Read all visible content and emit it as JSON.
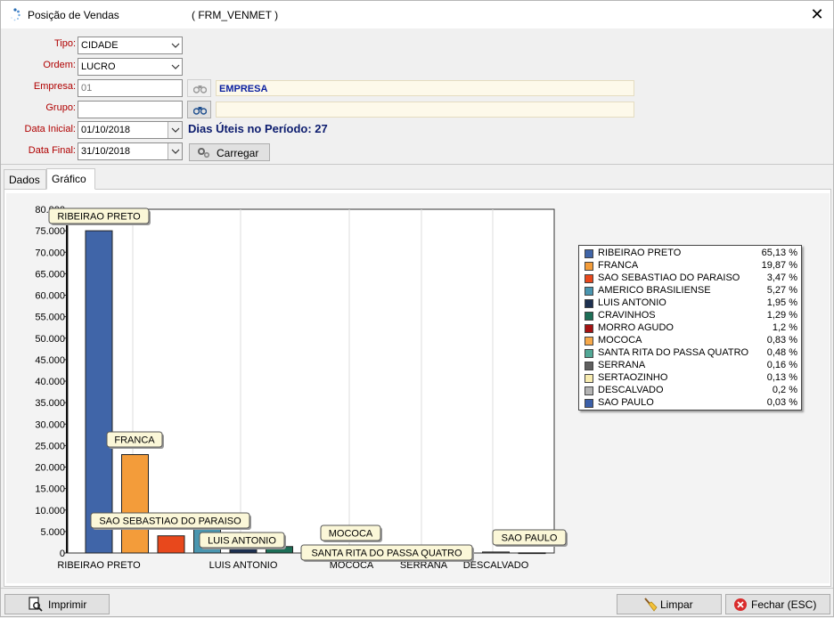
{
  "window": {
    "title": "Posição de Vendas",
    "form_code": "( FRM_VENMET )"
  },
  "filters": {
    "tipo_label": "Tipo:",
    "tipo_value": "CIDADE",
    "ordem_label": "Ordem:",
    "ordem_value": "LUCRO",
    "empresa_label": "Empresa:",
    "empresa_value": "01",
    "empresa_name": "EMPRESA",
    "grupo_label": "Grupo:",
    "grupo_value": "",
    "grupo_name": "",
    "data_inicial_label": "Data Inicial:",
    "data_inicial_value": "01/10/2018",
    "data_final_label": "Data Final:",
    "data_final_value": "31/10/2018",
    "dias_uteis": "Dias Úteis no Período: 27",
    "carregar_label": "Carregar"
  },
  "tabs": [
    {
      "label": "Dados",
      "active": false
    },
    {
      "label": "Gráfico",
      "active": true
    }
  ],
  "chart_data": {
    "type": "bar",
    "title": "",
    "xlabel": "",
    "ylabel": "",
    "ylim": [
      0,
      80000
    ],
    "yticks": [
      "0",
      "5.000",
      "10.000",
      "15.000",
      "20.000",
      "25.000",
      "30.000",
      "35.000",
      "40.000",
      "45.000",
      "50.000",
      "55.000",
      "60.000",
      "65.000",
      "70.000",
      "75.000",
      "80.000"
    ],
    "x_tick_labels": [
      "RIBEIRAO PRETO",
      "LUIS ANTONIO",
      "MOCOCA",
      "SERRANA",
      "DESCALVADO"
    ],
    "categories": [
      "RIBEIRAO PRETO",
      "FRANCA",
      "SAO SEBASTIAO DO PARAISO",
      "AMERICO BRASILIENSE",
      "LUIS ANTONIO",
      "CRAVINHOS",
      "MORRO AGUDO",
      "MOCOCA",
      "SANTA RITA DO PASSA QUATRO",
      "SERRANA",
      "SERTAOZINHO",
      "DESCALVADO",
      "SAO PAULO"
    ],
    "values": [
      75000,
      22900,
      4000,
      6100,
      2250,
      1500,
      1400,
      950,
      550,
      190,
      150,
      230,
      35
    ],
    "percentages": [
      "65,13 %",
      "19,87 %",
      "3,47 %",
      "5,27 %",
      "1,95 %",
      "1,29 %",
      "1,2 %",
      "0,83 %",
      "0,48 %",
      "0,16 %",
      "0,13 %",
      "0,2 %",
      "0,03 %"
    ],
    "colors": [
      "#4065a8",
      "#f39c3a",
      "#e8481c",
      "#4a96b0",
      "#1d3050",
      "#1c6e56",
      "#a51212",
      "#f7a94a",
      "#52a896",
      "#5f5f5f",
      "#f8ecb0",
      "#b4b4b4",
      "#3b5fa8"
    ],
    "callouts": [
      "RIBEIRAO PRETO",
      "FRANCA",
      "SAO SEBASTIAO DO PARAISO",
      "LUIS ANTONIO",
      "MOCOCA",
      "SANTA RITA DO PASSA QUATRO",
      "SAO PAULO"
    ],
    "legend_position": "right"
  },
  "footer": {
    "imprimir_label": "Imprimir",
    "limpar_label": "Limpar",
    "fechar_label": "Fechar (ESC)"
  }
}
